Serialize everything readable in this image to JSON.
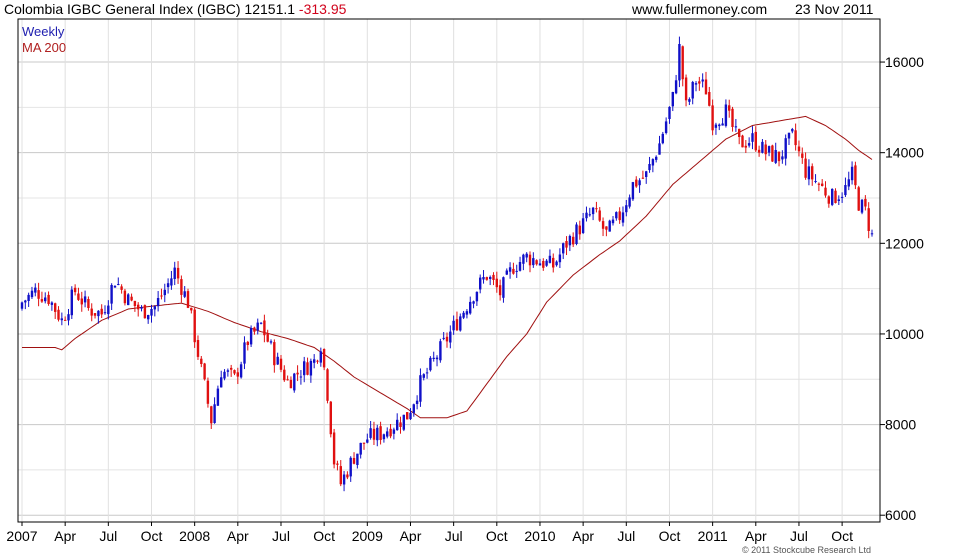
{
  "header": {
    "title": "Colombia IGBC General Index (IGBC) 12151.1",
    "change": "-313.95",
    "website": "www.fullermoney.com",
    "date": "23 Nov 2011"
  },
  "footer": {
    "copyright": "© 2011 Stockcube Research Ltd"
  },
  "colors": {
    "up": "#1010c8",
    "down": "#e01010",
    "ma": "#a01010",
    "grid": "#d8d8d8",
    "weekly_legend": "#2020b0",
    "ma_legend": "#b02020"
  },
  "chart_data": {
    "type": "candlestick",
    "title": "Colombia IGBC General Index (IGBC) 12151.1 -313.95",
    "legend": [
      "Weekly",
      "MA 200"
    ],
    "legend_position": "top-left",
    "grid": true,
    "y_axis_side": "right",
    "ylim": [
      5850,
      16950
    ],
    "yticks": [
      "6000",
      "8000",
      "10000",
      "12000",
      "14000",
      "16000"
    ],
    "x_tick_labels": [
      "2007",
      "Apr",
      "Jul",
      "Oct",
      "2008",
      "Apr",
      "Jul",
      "Oct",
      "2009",
      "Apr",
      "Jul",
      "Oct",
      "2010",
      "Apr",
      "Jul",
      "Oct",
      "2011",
      "Apr",
      "Jul",
      "Oct"
    ],
    "x_tick_weeks": [
      0,
      13,
      26,
      39,
      52,
      65,
      78,
      91,
      104,
      117,
      130,
      143,
      156,
      169,
      182,
      195,
      208,
      221,
      234,
      247
    ],
    "total_weeks": 256,
    "weekly_close_anchors": [
      [
        0,
        10700
      ],
      [
        4,
        10950
      ],
      [
        8,
        10800
      ],
      [
        12,
        10300
      ],
      [
        16,
        10950
      ],
      [
        20,
        10550
      ],
      [
        24,
        10450
      ],
      [
        28,
        11200
      ],
      [
        32,
        10750
      ],
      [
        36,
        10500
      ],
      [
        40,
        10600
      ],
      [
        44,
        11100
      ],
      [
        46,
        11400
      ],
      [
        50,
        10700
      ],
      [
        54,
        9200
      ],
      [
        57,
        8100
      ],
      [
        60,
        9200
      ],
      [
        64,
        9000
      ],
      [
        68,
        9850
      ],
      [
        72,
        10200
      ],
      [
        76,
        9500
      ],
      [
        80,
        8950
      ],
      [
        84,
        9200
      ],
      [
        88,
        9400
      ],
      [
        90,
        9800
      ],
      [
        92,
        8700
      ],
      [
        94,
        7200
      ],
      [
        96,
        6700
      ],
      [
        98,
        7000
      ],
      [
        100,
        7300
      ],
      [
        104,
        7700
      ],
      [
        108,
        7800
      ],
      [
        112,
        8000
      ],
      [
        116,
        8200
      ],
      [
        120,
        8900
      ],
      [
        124,
        9400
      ],
      [
        128,
        9900
      ],
      [
        132,
        10400
      ],
      [
        136,
        10900
      ],
      [
        140,
        11300
      ],
      [
        144,
        10900
      ],
      [
        148,
        11500
      ],
      [
        152,
        11700
      ],
      [
        156,
        11600
      ],
      [
        160,
        11500
      ],
      [
        164,
        12000
      ],
      [
        168,
        12350
      ],
      [
        172,
        12700
      ],
      [
        176,
        12200
      ],
      [
        180,
        12600
      ],
      [
        184,
        13300
      ],
      [
        188,
        13500
      ],
      [
        192,
        14200
      ],
      [
        196,
        15200
      ],
      [
        198,
        16300
      ],
      [
        200,
        15000
      ],
      [
        203,
        15600
      ],
      [
        206,
        15400
      ],
      [
        208,
        14700
      ],
      [
        212,
        14900
      ],
      [
        216,
        14200
      ],
      [
        220,
        14300
      ],
      [
        224,
        14000
      ],
      [
        228,
        13900
      ],
      [
        232,
        14350
      ],
      [
        236,
        13600
      ],
      [
        240,
        13300
      ],
      [
        244,
        13000
      ],
      [
        248,
        13200
      ],
      [
        250,
        13500
      ],
      [
        252,
        12900
      ],
      [
        254,
        12700
      ],
      [
        256,
        12151
      ]
    ],
    "ma200_anchors": [
      [
        0,
        9700
      ],
      [
        10,
        9700
      ],
      [
        12,
        9650
      ],
      [
        16,
        9900
      ],
      [
        24,
        10300
      ],
      [
        32,
        10550
      ],
      [
        40,
        10620
      ],
      [
        48,
        10680
      ],
      [
        56,
        10500
      ],
      [
        64,
        10250
      ],
      [
        72,
        10050
      ],
      [
        80,
        9900
      ],
      [
        88,
        9700
      ],
      [
        94,
        9400
      ],
      [
        100,
        9050
      ],
      [
        108,
        8700
      ],
      [
        116,
        8350
      ],
      [
        120,
        8150
      ],
      [
        128,
        8150
      ],
      [
        134,
        8300
      ],
      [
        140,
        8900
      ],
      [
        146,
        9500
      ],
      [
        152,
        10000
      ],
      [
        158,
        10700
      ],
      [
        166,
        11300
      ],
      [
        174,
        11750
      ],
      [
        180,
        12050
      ],
      [
        188,
        12600
      ],
      [
        196,
        13300
      ],
      [
        204,
        13800
      ],
      [
        212,
        14300
      ],
      [
        220,
        14600
      ],
      [
        228,
        14700
      ],
      [
        236,
        14800
      ],
      [
        242,
        14600
      ],
      [
        248,
        14300
      ],
      [
        252,
        14050
      ],
      [
        256,
        13850
      ]
    ]
  }
}
